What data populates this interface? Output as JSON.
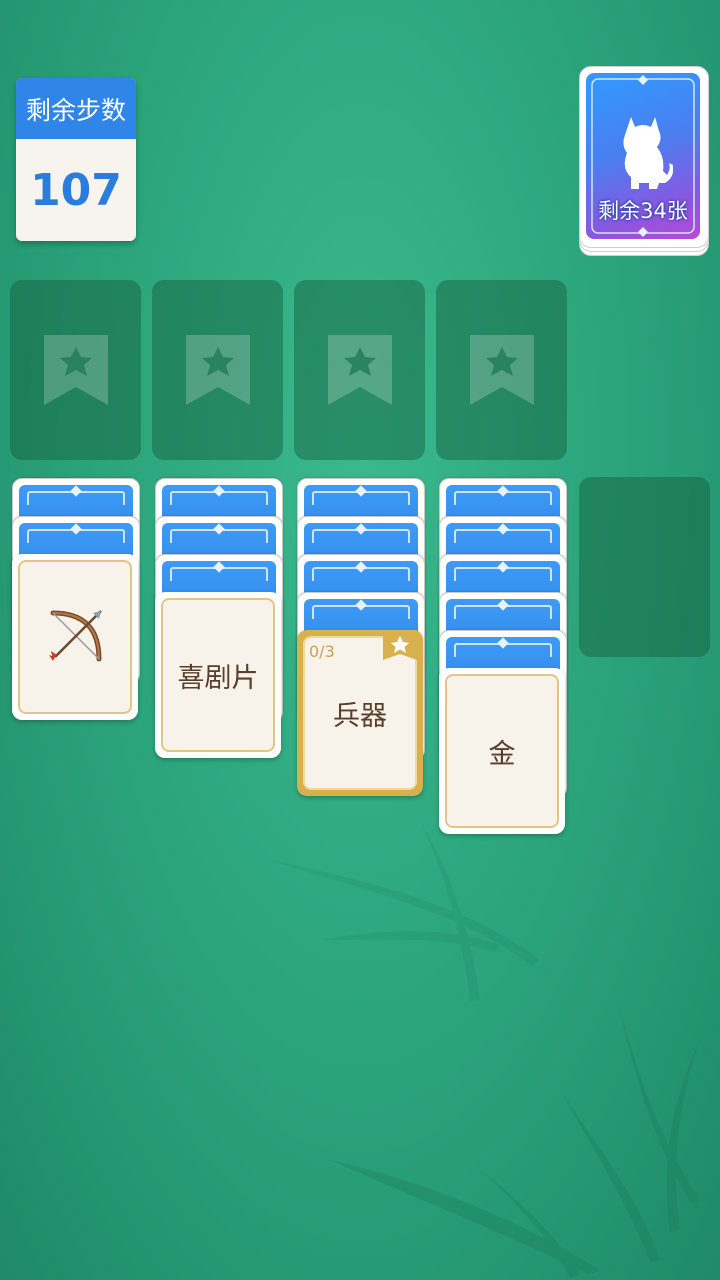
{
  "moves": {
    "label": "剩余步数",
    "value": "107"
  },
  "deck": {
    "remaining_label": "剩余34张"
  },
  "foundations": [
    {
      "icon": "star-bookmark-icon"
    },
    {
      "icon": "star-bookmark-icon"
    },
    {
      "icon": "star-bookmark-icon"
    },
    {
      "icon": "star-bookmark-icon"
    }
  ],
  "columns": [
    {
      "hidden_cards": 2,
      "face_card": {
        "icon": "bow-and-arrow-icon",
        "text": ""
      }
    },
    {
      "hidden_cards": 3,
      "face_card": {
        "text": "喜剧片"
      }
    },
    {
      "hidden_cards": 4,
      "face_card": {
        "text": "兵器",
        "progress": "0/3",
        "selected": true
      }
    },
    {
      "hidden_cards": 5,
      "face_card": {
        "text": "金"
      }
    }
  ],
  "colors": {
    "accent_blue": "#2f86e8",
    "card_gold": "#d9b04e",
    "table_green": "#2aa27a"
  }
}
